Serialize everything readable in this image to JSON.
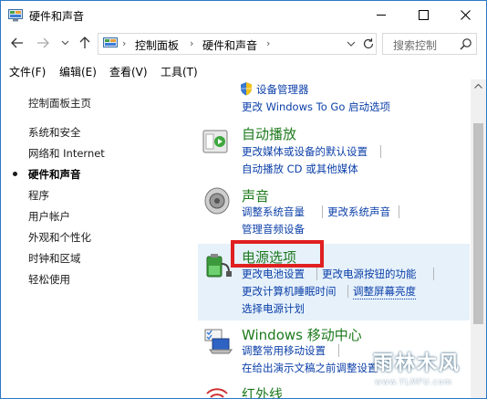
{
  "window": {
    "title": "硬件和声音"
  },
  "address": {
    "segments": [
      "控制面板",
      "硬件和声音"
    ],
    "search_placeholder": "搜索控制"
  },
  "menu": [
    "文件(F)",
    "编辑(E)",
    "查看(V)",
    "工具(T)"
  ],
  "nav": {
    "home": "控制面板主页",
    "items": [
      "系统和安全",
      "网络和 Internet",
      "硬件和声音",
      "程序",
      "用户帐户",
      "外观和个性化",
      "时钟和区域",
      "轻松使用"
    ],
    "current_index": 2
  },
  "categories": {
    "devices": {
      "links": [
        "设备管理器",
        "更改 Windows To Go 启动选项"
      ]
    },
    "autoplay": {
      "title": "自动播放",
      "links": [
        "更改媒体或设备的默认设置",
        "自动播放 CD 或其他媒体"
      ]
    },
    "sound": {
      "title": "声音",
      "links": [
        "调整系统音量",
        "更改系统声音",
        "管理音频设备"
      ]
    },
    "power": {
      "title": "电源选项",
      "links": [
        "更改电池设置",
        "更改电源按钮的功能",
        "更改计算机睡眠时间",
        "调整屏幕亮度",
        "选择电源计划"
      ]
    },
    "mobility": {
      "title": "Windows 移动中心",
      "links": [
        "调整常用移动设置",
        "在给出演示文稿之前调整设置"
      ]
    },
    "infrared": {
      "title": "红外线"
    }
  },
  "watermark": {
    "text": "雨林木风",
    "url": "www.YLMFU.com"
  },
  "colors": {
    "accent": "#2b78c5",
    "category_title": "#1e7a1e",
    "link": "#0b3fa8",
    "highlight": "#e6f1fa",
    "callout": "#e02020"
  }
}
